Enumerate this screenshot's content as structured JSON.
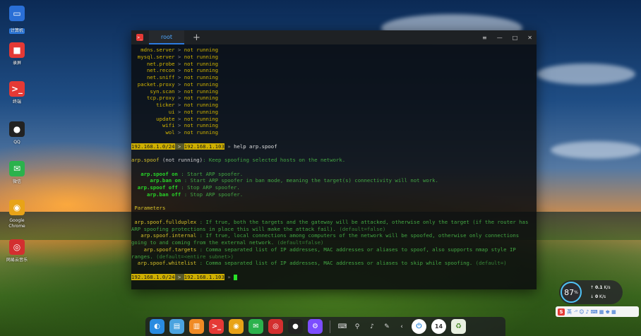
{
  "desktop": {
    "icons": [
      {
        "name": "computer",
        "label": "计算机",
        "glyph": "▭",
        "color": "#2a6fd6"
      },
      {
        "name": "screen-recorder",
        "label": "录屏",
        "glyph": "■",
        "color": "#e53935"
      },
      {
        "name": "terminal",
        "label": "终端",
        "glyph": ">_",
        "color": "#e53935"
      },
      {
        "name": "qq",
        "label": "QQ",
        "glyph": "●",
        "color": "#222222"
      },
      {
        "name": "wechat",
        "label": "微信",
        "glyph": "✉",
        "color": "#2bb24c"
      },
      {
        "name": "google-chrome",
        "label": "Google Chrome",
        "glyph": "◉",
        "color": "#e8a317"
      },
      {
        "name": "netease-music",
        "label": "网易云音乐",
        "glyph": "◎",
        "color": "#d32f2f"
      }
    ]
  },
  "terminal": {
    "tab_label": "root",
    "add_tab": "+",
    "ctrl_menu": "≡",
    "ctrl_min": "—",
    "ctrl_max": "□",
    "ctrl_close": "✕",
    "modules": [
      {
        "name": "mdns.server",
        "status": "not running"
      },
      {
        "name": "mysql.server",
        "status": "not running"
      },
      {
        "name": "net.probe",
        "status": "not running"
      },
      {
        "name": "net.recon",
        "status": "not running"
      },
      {
        "name": "net.sniff",
        "status": "not running"
      },
      {
        "name": "packet.proxy",
        "status": "not running"
      },
      {
        "name": "syn.scan",
        "status": "not running"
      },
      {
        "name": "tcp.proxy",
        "status": "not running"
      },
      {
        "name": "ticker",
        "status": "not running"
      },
      {
        "name": "ui",
        "status": "not running"
      },
      {
        "name": "update",
        "status": "not running"
      },
      {
        "name": "wifi",
        "status": "not running"
      },
      {
        "name": "wol",
        "status": "not running"
      }
    ],
    "sep": ">",
    "prompt_net": "192.168.1.0/24",
    "prompt_gt": ">",
    "prompt_ip": "192.168.1.103",
    "prompt_arrow": "»",
    "command": "help arp.spoof",
    "header_name": "arp.spoof",
    "header_status": "(not running)",
    "header_desc": ": Keep spoofing selected hosts on the network.",
    "commands": [
      {
        "pad": "   ",
        "cmd": "arp.spoof on",
        "desc": " : Start ARP spoofer."
      },
      {
        "pad": "      ",
        "cmd": "arp.ban on",
        "desc": " : Start ARP spoofer in ban mode, meaning the target(s) connectivity will not work."
      },
      {
        "pad": "  ",
        "cmd": "arp.spoof off",
        "desc": " : Stop ARP spoofer."
      },
      {
        "pad": "     ",
        "cmd": "arp.ban off",
        "desc": " : Stop ARP spoofer."
      }
    ],
    "params_title": "Parameters",
    "params": [
      {
        "pad": " ",
        "name": "arp.spoof.fullduplex",
        "desc": " : If true, both the targets and the gateway will be attacked, otherwise only the target (if the router has ARP spoofing protections in place this will make the attack fail).",
        "def": " (default=false)"
      },
      {
        "pad": "   ",
        "name": "arp.spoof.internal",
        "desc": " : If true, local connections among computers of the network will be spoofed, otherwise only connections going to and coming from the external network.",
        "def": " (default=false)"
      },
      {
        "pad": "    ",
        "name": "arp.spoof.targets",
        "desc": " : Comma separated list of IP addresses, MAC addresses or aliases to spoof, also supports nmap style IP ranges.",
        "def": " (default=<entire subnet>)"
      },
      {
        "pad": "  ",
        "name": "arp.spoof.whitelist",
        "desc": " : Comma separated list of IP addresses, MAC addresses or aliases to skip while spoofing.",
        "def": " (default=)"
      }
    ]
  },
  "dock": {
    "items": [
      {
        "name": "launcher",
        "glyph": "◐",
        "color": "#2a8be0"
      },
      {
        "name": "file-manager",
        "glyph": "▤",
        "color": "#4aa3df"
      },
      {
        "name": "app-store",
        "glyph": "▥",
        "color": "#f08a24"
      },
      {
        "name": "terminal",
        "glyph": ">_",
        "color": "#e53935"
      },
      {
        "name": "chrome",
        "glyph": "◉",
        "color": "#e8a317"
      },
      {
        "name": "wechat",
        "glyph": "✉",
        "color": "#2bb24c"
      },
      {
        "name": "netease-music",
        "glyph": "◎",
        "color": "#d32f2f"
      },
      {
        "name": "qq",
        "glyph": "●",
        "color": "#222222"
      },
      {
        "name": "settings",
        "glyph": "⚙",
        "color": "#7c4dff"
      }
    ],
    "tray": [
      "⌨",
      "⚲",
      "♪",
      "✎",
      "‹"
    ],
    "power_glyph": "⏻",
    "clock": "14",
    "trash_glyph": "♻"
  },
  "speed_widget": {
    "percent": "87",
    "percent_unit": "%",
    "up": "0.1",
    "up_unit": "K/s",
    "down": "0",
    "down_unit": "K/s"
  },
  "ime_bar": {
    "logo": "S",
    "lang": "英",
    "icons": "·⁰ ☺ ♪ ⌨ ▦ ♚ ▦"
  }
}
